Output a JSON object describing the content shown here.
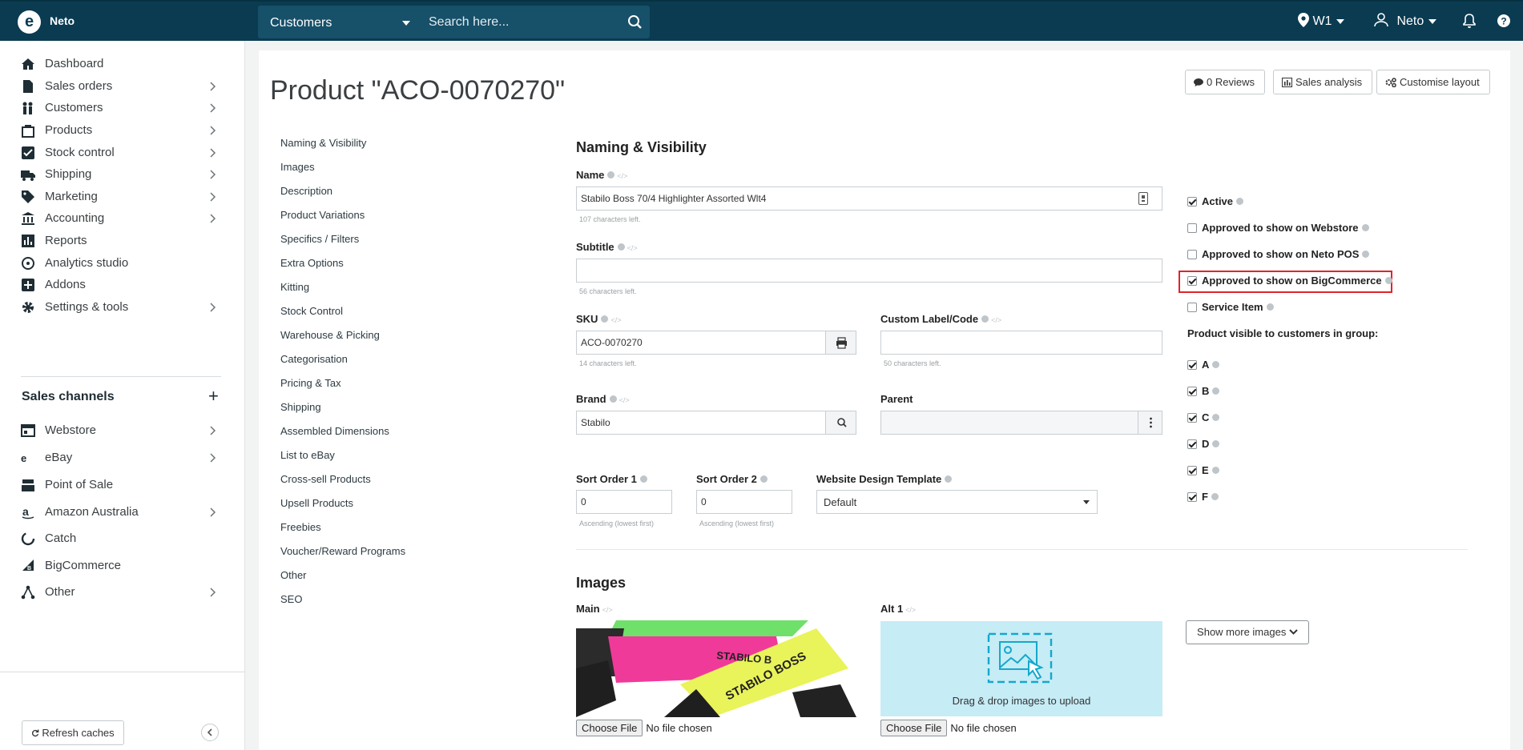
{
  "topbar": {
    "brand": "Neto",
    "search_scope": "Customers",
    "search_placeholder": "Search here...",
    "location": "W1",
    "user": "Neto"
  },
  "sidebar": {
    "items": [
      {
        "label": "Dashboard"
      },
      {
        "label": "Sales orders"
      },
      {
        "label": "Customers"
      },
      {
        "label": "Products"
      },
      {
        "label": "Stock control"
      },
      {
        "label": "Shipping"
      },
      {
        "label": "Marketing"
      },
      {
        "label": "Accounting"
      },
      {
        "label": "Reports"
      },
      {
        "label": "Analytics studio"
      },
      {
        "label": "Addons"
      },
      {
        "label": "Settings & tools"
      }
    ],
    "channels_title": "Sales channels",
    "channels": [
      {
        "label": "Webstore"
      },
      {
        "label": "eBay"
      },
      {
        "label": "Point of Sale"
      },
      {
        "label": "Amazon Australia"
      },
      {
        "label": "Catch"
      },
      {
        "label": "BigCommerce"
      },
      {
        "label": "Other"
      }
    ],
    "refresh_label": "Refresh caches"
  },
  "page": {
    "title": "Product \"ACO-0070270\"",
    "reviews_label": "0 Reviews",
    "sales_label": "Sales analysis",
    "customise_label": "Customise layout"
  },
  "subnav": [
    "Naming & Visibility",
    "Images",
    "Description",
    "Product Variations",
    "Specifics / Filters",
    "Extra Options",
    "Kitting",
    "Stock Control",
    "Warehouse & Picking",
    "Categorisation",
    "Pricing & Tax",
    "Shipping",
    "Assembled Dimensions",
    "List to eBay",
    "Cross-sell Products",
    "Upsell Products",
    "Freebies",
    "Voucher/Reward Programs",
    "Other",
    "SEO"
  ],
  "naming": {
    "heading": "Naming & Visibility",
    "name_label": "Name",
    "name_value": "Stabilo Boss 70/4 Highlighter Assorted Wlt4",
    "name_hint": "107 characters left.",
    "subtitle_label": "Subtitle",
    "subtitle_value": "",
    "subtitle_hint": "56 characters left.",
    "sku_label": "SKU",
    "sku_value": "ACO-0070270",
    "sku_hint": "14 characters left.",
    "custom_label": "Custom Label/Code",
    "custom_value": "",
    "custom_hint": "50 characters left.",
    "brand_label": "Brand",
    "brand_value": "Stabilo",
    "parent_label": "Parent",
    "parent_value": "",
    "sort1_label": "Sort Order 1",
    "sort1_value": "0",
    "sort1_hint": "Ascending (lowest first)",
    "sort2_label": "Sort Order 2",
    "sort2_value": "0",
    "sort2_hint": "Ascending (lowest first)",
    "template_label": "Website Design Template",
    "template_value": "Default"
  },
  "visibility": {
    "active": {
      "label": "Active",
      "checked": true
    },
    "webstore": {
      "label": "Approved to show on Webstore",
      "checked": false
    },
    "pos": {
      "label": "Approved to show on Neto POS",
      "checked": false
    },
    "bigcommerce": {
      "label": "Approved to show on BigCommerce",
      "checked": true
    },
    "service": {
      "label": "Service Item",
      "checked": false
    },
    "groups_label": "Product visible to customers in group:",
    "groups": [
      {
        "label": "A",
        "checked": true
      },
      {
        "label": "B",
        "checked": true
      },
      {
        "label": "C",
        "checked": true
      },
      {
        "label": "D",
        "checked": true
      },
      {
        "label": "E",
        "checked": true
      },
      {
        "label": "F",
        "checked": true
      }
    ]
  },
  "images": {
    "heading": "Images",
    "main_label": "Main",
    "alt_label": "Alt 1",
    "drop_text": "Drag & drop images to upload",
    "choose_label": "Choose File",
    "no_file": "No file chosen",
    "more_label": "Show more images"
  },
  "colors": {
    "topbar": "#0a3b51",
    "highlight": "#e0242b",
    "dropzone": "#c6ecf6"
  }
}
